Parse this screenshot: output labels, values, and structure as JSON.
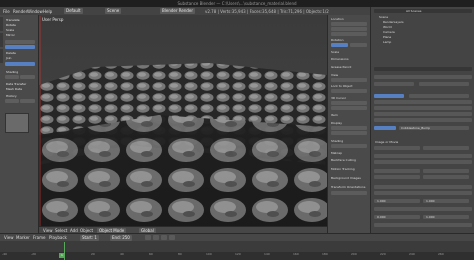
{
  "window": {
    "title": "Substance Blender — C:\\Users\\...\\substance_material.blend"
  },
  "topmenu": {
    "items": [
      "File",
      "Render",
      "Window",
      "Help"
    ],
    "layout": "Default",
    "scene": "Scene",
    "engine": "Blender Render",
    "stats": "v2.78 | Verts:35,943 | Faces:35,648 | Tris:71,296 | Objects:1/2"
  },
  "viewport": {
    "label": "User Persp",
    "header": [
      "View",
      "Select",
      "Add",
      "Object",
      "Object Mode",
      "Global"
    ]
  },
  "left_panel": {
    "tools": [
      "Translate",
      "Rotate",
      "Scale",
      "Mirror",
      "Edit",
      "Duplicate",
      "Delete",
      "Join",
      "Set Origin",
      "Shading",
      "Smooth",
      "Flat",
      "Data Transfer",
      "Mesh Data",
      "History"
    ],
    "undo": [
      "Undo",
      "Redo"
    ]
  },
  "right_strip": {
    "items": [
      "Location",
      "X: 0 m",
      "Y: 0 m",
      "Z: 0 m",
      "Rotation",
      "Scale",
      "Dimensions",
      "Grease Pencil",
      "View",
      "Lens: 35",
      "Lock to Object",
      "3D Cursor",
      "Item",
      "Display",
      "Shading",
      "Textured",
      "Matcap",
      "Backface Culling",
      "Motion Tracking",
      "Background Images",
      "Transform Orientations"
    ]
  },
  "properties": {
    "header": "All Scenes",
    "outliner": [
      "Scene",
      "RenderLayers",
      "World",
      "Camera",
      "Plane",
      "Lamp"
    ],
    "texture_name": "Cobblestone_Bump",
    "type": "Image or Movie",
    "fields": [
      "Preview",
      "Colors",
      "Image",
      "Source: Single Image",
      "Mapping",
      "Coordinates: UV",
      "Map: UVMap",
      "Influence",
      "Color",
      "Normal",
      "Blend: Mix"
    ],
    "values": {
      "normal": "1.000",
      "color": "1.000",
      "offset": "0.000",
      "size": "1.000"
    }
  },
  "timeline": {
    "header": [
      "View",
      "Marker",
      "Frame",
      "Playback"
    ],
    "start_label": "Start: 1",
    "end_label": "End: 250",
    "current_frame": "1",
    "ticks": [
      "-40",
      "-20",
      "0",
      "20",
      "40",
      "60",
      "80",
      "100",
      "120",
      "140",
      "160",
      "180",
      "200",
      "220",
      "240",
      "260"
    ]
  },
  "colors": {
    "accent": "#5680c2",
    "frame": "#57a85b",
    "bg": "#3d3d3d"
  }
}
